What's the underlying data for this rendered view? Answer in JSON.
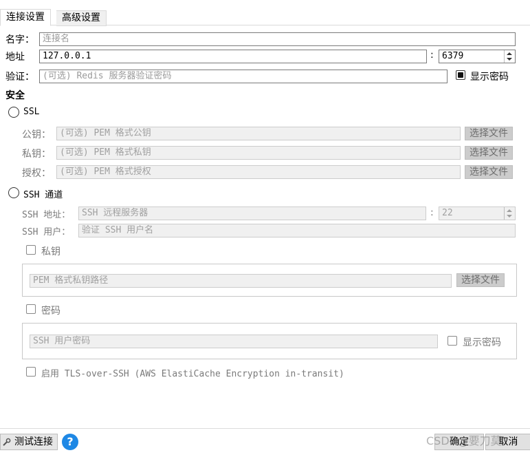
{
  "tabs": [
    {
      "label": "连接设置"
    },
    {
      "label": "高级设置"
    }
  ],
  "connection": {
    "name_label": "名字：",
    "name_placeholder": "连接名",
    "address_label": "地址",
    "address_value": "127.0.0.1",
    "colon": ":",
    "port_value": "6379",
    "auth_label": "验证：",
    "auth_placeholder": "(可选) Redis 服务器验证密码",
    "show_password_label": "显示密码"
  },
  "security": {
    "heading": "安全",
    "ssl_label": "SSL",
    "public_key_label": "公钥：",
    "public_key_placeholder": "(可选) PEM 格式公钥",
    "private_key_label": "私钥：",
    "private_key_placeholder": "(可选) PEM 格式私钥",
    "authority_label": "授权：",
    "authority_placeholder": "(可选) PEM 格式授权",
    "choose_file_label": "选择文件"
  },
  "ssh": {
    "tunnel_label": "SSH 通道",
    "address_label": "SSH 地址：",
    "address_placeholder": "SSH 远程服务器",
    "colon": ":",
    "port_value": "22",
    "user_label": "SSH 用户：",
    "user_placeholder": "验证 SSH 用户名",
    "private_key_checkbox_label": "私钥",
    "private_key_path_placeholder": "PEM 格式私钥路径",
    "choose_file_label": "选择文件",
    "password_checkbox_label": "密码",
    "password_placeholder": "SSH 用户密码",
    "show_password_label": "显示密码",
    "tls_over_ssh_label": "启用 TLS-over-SSH (AWS ElastiCache Encryption in-transit)"
  },
  "footer": {
    "test_connection_label": "测试连接",
    "help_glyph": "?",
    "ok_label": "确定",
    "cancel_label": "取消",
    "watermark": "CSDN@要刀莫"
  }
}
